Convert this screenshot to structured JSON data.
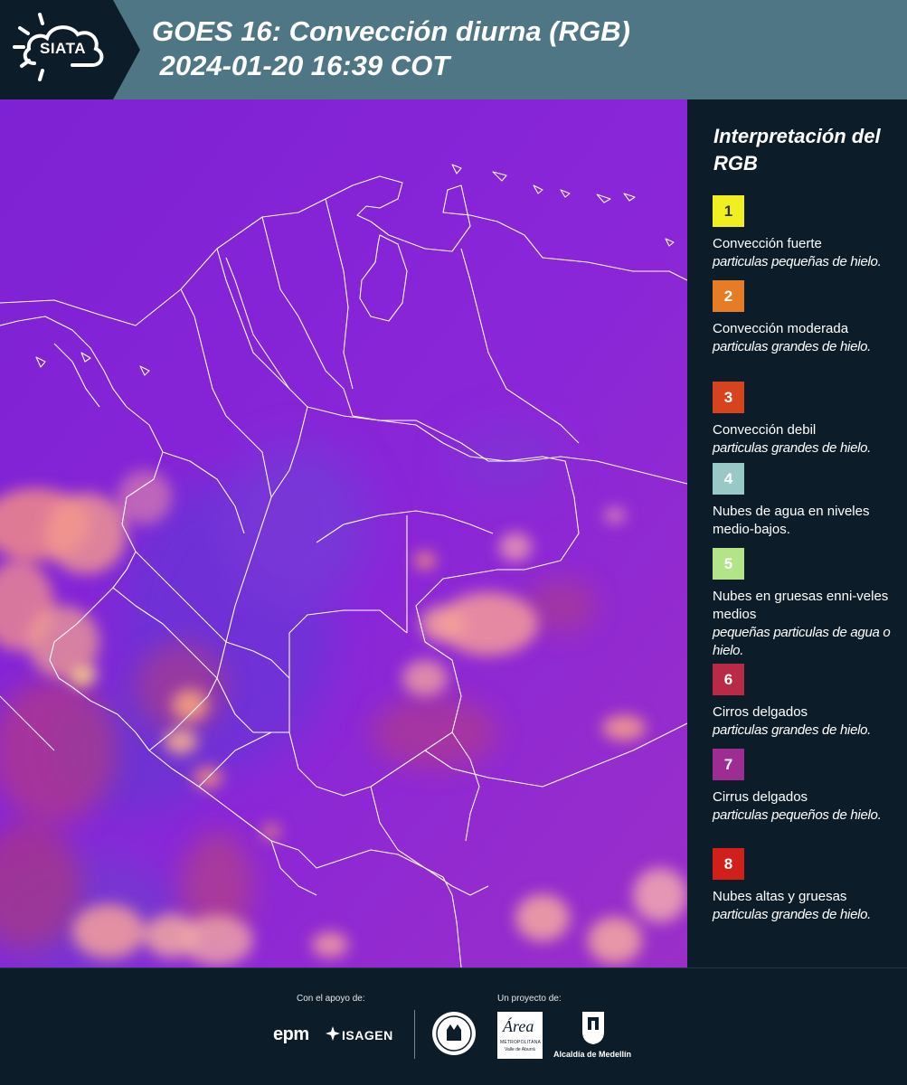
{
  "header": {
    "logo_text": "SIATA",
    "title": "GOES 16: Convección diurna (RGB)\n 2024-01-20 16:39 COT"
  },
  "legend": {
    "title": "Interpretación del RGB",
    "items": [
      {
        "number": "1",
        "color": "#f0f020",
        "text_color": "#333333",
        "name": "Convección fuerte",
        "desc": "particulas pequeñas de hielo."
      },
      {
        "number": "2",
        "color": "#e77c27",
        "text_color": "#ffffff",
        "name": "Convección moderada",
        "desc": "particulas grandes de hielo."
      },
      {
        "number": "3",
        "color": "#d7431e",
        "text_color": "#ffffff",
        "name": "Convección debil",
        "desc": "particulas grandes de hielo."
      },
      {
        "number": "4",
        "color": "#99c9c6",
        "text_color": "#ffffff",
        "name": "Nubes de agua en niveles medio-bajos.",
        "desc": ""
      },
      {
        "number": "5",
        "color": "#b3e588",
        "text_color": "#ffffff",
        "name": "Nubes en gruesas enni-veles medios",
        "desc": "pequeñas particulas de agua o hielo."
      },
      {
        "number": "6",
        "color": "#b92a47",
        "text_color": "#ffffff",
        "name": "Cirros delgados",
        "desc": "particulas grandes de hielo."
      },
      {
        "number": "7",
        "color": "#9d2d92",
        "text_color": "#ffffff",
        "name": "Cirrus delgados",
        "desc": "particulas pequeños de hielo."
      },
      {
        "number": "8",
        "color": "#d11f1b",
        "text_color": "#ffffff",
        "name": "Nubes altas y gruesas",
        "desc": "particulas grandes de hielo."
      }
    ]
  },
  "footer": {
    "support_label": "Con el apoyo de:",
    "project_label": "Un proyecto de:",
    "sponsors": [
      "epm",
      "ISAGEN"
    ],
    "partners": [
      "ÁREA METROPOLITANA Valle de Aburrá",
      "Alcaldía de Medellín"
    ],
    "area_logo_text": "Área",
    "area_logo_subtitle": "METROPOLITANA",
    "area_logo_tagline": "Valle de Aburrá"
  },
  "colors": {
    "header_bg": "#4f7684",
    "logo_bg": "#0c1d29",
    "panel_bg": "#0c1d29",
    "map_base": "#8a26d6"
  },
  "icons": [
    "siata-sun-cloud-logo",
    "epm-logo",
    "isagen-logo",
    "seal-emblem",
    "area-metropolitana-logo",
    "alcaldia-medellin-logo"
  ]
}
